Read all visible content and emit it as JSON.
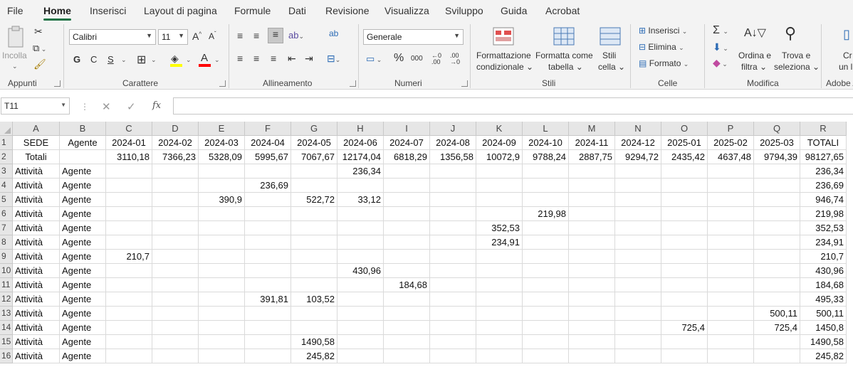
{
  "menu": {
    "tabs": [
      "File",
      "Home",
      "Inserisci",
      "Layout di pagina",
      "Formule",
      "Dati",
      "Revisione",
      "Visualizza",
      "Sviluppo",
      "Guida",
      "Acrobat"
    ],
    "active": "Home"
  },
  "ribbon": {
    "appunti": {
      "label": "Appunti",
      "paste": "Incolla"
    },
    "carattere": {
      "label": "Carattere",
      "font_name": "Calibri",
      "font_size": "11",
      "bold": "G",
      "italic": "C",
      "underline": "S",
      "grow": "A^",
      "shrink": "Aˇ"
    },
    "allineamento": {
      "label": "Allineamento"
    },
    "numeri": {
      "label": "Numeri",
      "format": "Generale",
      "percent": "%",
      "thousands": "000"
    },
    "stili": {
      "label": "Stili",
      "cond_format_1": "Formattazione",
      "cond_format_2": "condizionale",
      "format_table_1": "Formatta come",
      "format_table_2": "tabella",
      "cell_styles_1": "Stili",
      "cell_styles_2": "cella"
    },
    "celle": {
      "label": "Celle",
      "insert": "Inserisci",
      "delete": "Elimina",
      "format": "Formato"
    },
    "modifica": {
      "label": "Modifica",
      "sort_1": "Ordina e",
      "sort_2": "filtra",
      "find_1": "Trova e",
      "find_2": "seleziona"
    },
    "adobe": {
      "label": "Adobe A",
      "create_1": "Cr",
      "create_2": "un l"
    }
  },
  "formula_bar": {
    "name_box": "T11",
    "cancel": "✕",
    "enter": "✓",
    "fx": "fx",
    "formula": ""
  },
  "columns": [
    "A",
    "B",
    "C",
    "D",
    "E",
    "F",
    "G",
    "H",
    "I",
    "J",
    "K",
    "L",
    "M",
    "N",
    "O",
    "P",
    "Q",
    "R"
  ],
  "rows": [
    {
      "n": "1",
      "cells": [
        "SEDE",
        "Agente",
        "2024-01",
        "2024-02",
        "2024-03",
        "2024-04",
        "2024-05",
        "2024-06",
        "2024-07",
        "2024-08",
        "2024-09",
        "2024-10",
        "2024-11",
        "2024-12",
        "2025-01",
        "2025-02",
        "2025-03",
        "TOTALI"
      ]
    },
    {
      "n": "2",
      "cells": [
        "Totali",
        "",
        "3110,18",
        "7366,23",
        "5328,09",
        "5995,67",
        "7067,67",
        "12174,04",
        "6818,29",
        "1356,58",
        "10072,9",
        "9788,24",
        "2887,75",
        "9294,72",
        "2435,42",
        "4637,48",
        "9794,39",
        "98127,65"
      ]
    },
    {
      "n": "3",
      "cells": [
        "Attività",
        "Agente",
        "",
        "",
        "",
        "",
        "",
        "236,34",
        "",
        "",
        "",
        "",
        "",
        "",
        "",
        "",
        "",
        "236,34"
      ]
    },
    {
      "n": "4",
      "cells": [
        "Attività",
        "Agente",
        "",
        "",
        "",
        "236,69",
        "",
        "",
        "",
        "",
        "",
        "",
        "",
        "",
        "",
        "",
        "",
        "236,69"
      ]
    },
    {
      "n": "5",
      "cells": [
        "Attività",
        "Agente",
        "",
        "",
        "390,9",
        "",
        "522,72",
        "33,12",
        "",
        "",
        "",
        "",
        "",
        "",
        "",
        "",
        "",
        "946,74"
      ]
    },
    {
      "n": "6",
      "cells": [
        "Attività",
        "Agente",
        "",
        "",
        "",
        "",
        "",
        "",
        "",
        "",
        "",
        "219,98",
        "",
        "",
        "",
        "",
        "",
        "219,98"
      ]
    },
    {
      "n": "7",
      "cells": [
        "Attività",
        "Agente",
        "",
        "",
        "",
        "",
        "",
        "",
        "",
        "",
        "352,53",
        "",
        "",
        "",
        "",
        "",
        "",
        "352,53"
      ]
    },
    {
      "n": "8",
      "cells": [
        "Attività",
        "Agente",
        "",
        "",
        "",
        "",
        "",
        "",
        "",
        "",
        "234,91",
        "",
        "",
        "",
        "",
        "",
        "",
        "234,91"
      ]
    },
    {
      "n": "9",
      "cells": [
        "Attività",
        "Agente",
        "210,7",
        "",
        "",
        "",
        "",
        "",
        "",
        "",
        "",
        "",
        "",
        "",
        "",
        "",
        "",
        "210,7"
      ]
    },
    {
      "n": "10",
      "cells": [
        "Attività",
        "Agente",
        "",
        "",
        "",
        "",
        "",
        "430,96",
        "",
        "",
        "",
        "",
        "",
        "",
        "",
        "",
        "",
        "430,96"
      ]
    },
    {
      "n": "11",
      "cells": [
        "Attività",
        "Agente",
        "",
        "",
        "",
        "",
        "",
        "",
        "184,68",
        "",
        "",
        "",
        "",
        "",
        "",
        "",
        "",
        "184,68"
      ]
    },
    {
      "n": "12",
      "cells": [
        "Attività",
        "Agente",
        "",
        "",
        "",
        "391,81",
        "103,52",
        "",
        "",
        "",
        "",
        "",
        "",
        "",
        "",
        "",
        "",
        "495,33"
      ]
    },
    {
      "n": "13",
      "cells": [
        "Attività",
        "Agente",
        "",
        "",
        "",
        "",
        "",
        "",
        "",
        "",
        "",
        "",
        "",
        "",
        "",
        "",
        "500,11",
        "500,11"
      ]
    },
    {
      "n": "14",
      "cells": [
        "Attività",
        "Agente",
        "",
        "",
        "",
        "",
        "",
        "",
        "",
        "",
        "",
        "",
        "",
        "",
        "725,4",
        "",
        "725,4",
        "1450,8"
      ]
    },
    {
      "n": "15",
      "cells": [
        "Attività",
        "Agente",
        "",
        "",
        "",
        "",
        "1490,58",
        "",
        "",
        "",
        "",
        "",
        "",
        "",
        "",
        "",
        "",
        "1490,58"
      ]
    },
    {
      "n": "16",
      "cells": [
        "Attività",
        "Agente",
        "",
        "",
        "",
        "",
        "245,82",
        "",
        "",
        "",
        "",
        "",
        "",
        "",
        "",
        "",
        "",
        "245,82"
      ]
    }
  ],
  "colors": {
    "accent": "#217346",
    "font_color_bar": "#ff0000",
    "fill_color_bar": "#ffff00"
  }
}
